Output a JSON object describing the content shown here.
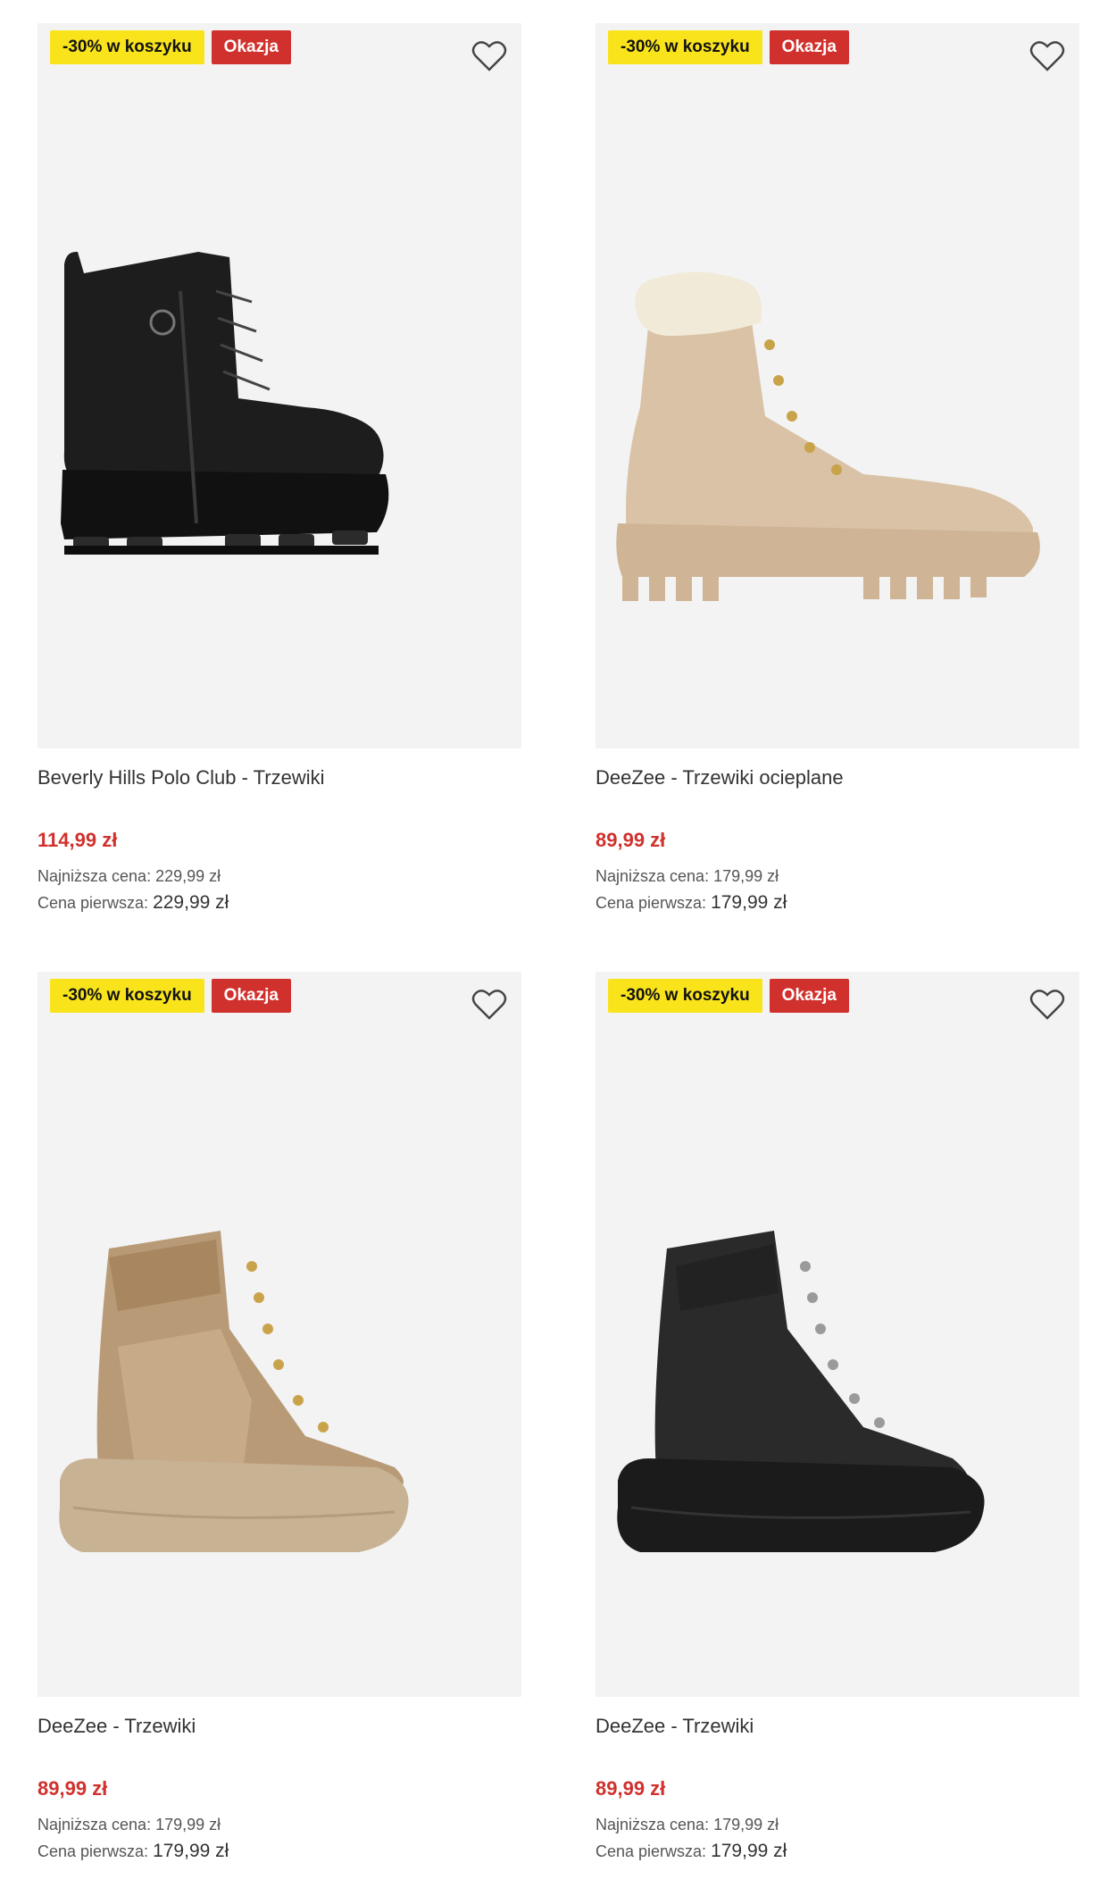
{
  "products": [
    {
      "promo_badge": "-30% w koszyku",
      "deal_badge": "Okazja",
      "name": "Beverly Hills Polo Club - Trzewiki",
      "price": "114,99 zł",
      "lowest_label": "Najniższa cena:",
      "lowest_value": "229,99 zł",
      "first_label": "Cena pierwsza:",
      "first_value": "229,99 zł",
      "image": "black-leather-combat-boot"
    },
    {
      "promo_badge": "-30% w koszyku",
      "deal_badge": "Okazja",
      "name": "DeeZee - Trzewiki ocieplane",
      "price": "89,99 zł",
      "lowest_label": "Najniższa cena:",
      "lowest_value": "179,99 zł",
      "first_label": "Cena pierwsza:",
      "first_value": "179,99 zł",
      "image": "beige-fur-lined-boot"
    },
    {
      "promo_badge": "-30% w koszyku",
      "deal_badge": "Okazja",
      "name": "DeeZee - Trzewiki",
      "price": "89,99 zł",
      "lowest_label": "Najniższa cena:",
      "lowest_value": "179,99 zł",
      "first_label": "Cena pierwsza:",
      "first_value": "179,99 zł",
      "image": "tan-hiking-sneaker-boot"
    },
    {
      "promo_badge": "-30% w koszyku",
      "deal_badge": "Okazja",
      "name": "DeeZee - Trzewiki",
      "price": "89,99 zł",
      "lowest_label": "Najniższa cena:",
      "lowest_value": "179,99 zł",
      "first_label": "Cena pierwsza:",
      "first_value": "179,99 zł",
      "image": "black-hiking-sneaker-boot"
    }
  ],
  "colors": {
    "promo_bg": "#f9e41c",
    "deal_bg": "#d0312d",
    "price": "#d0312d",
    "image_bg": "#f3f3f3"
  }
}
